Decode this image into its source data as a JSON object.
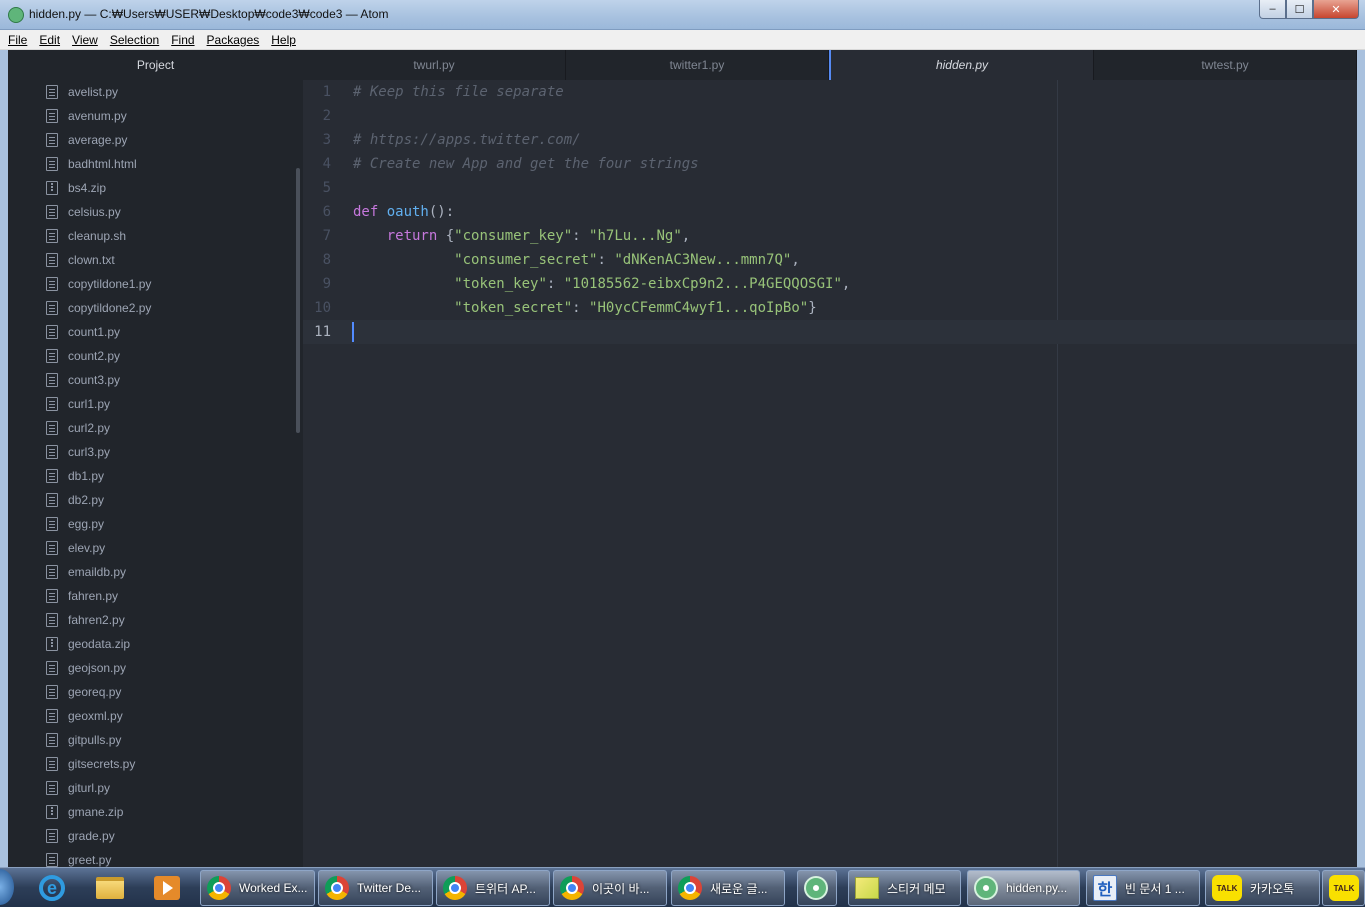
{
  "window": {
    "title": "hidden.py — C:₩Users₩USER₩Desktop₩code3₩code3 — Atom",
    "minimize": "‒",
    "maximize": "☐",
    "close": "✕"
  },
  "menu": [
    "File",
    "Edit",
    "View",
    "Selection",
    "Find",
    "Packages",
    "Help"
  ],
  "tree": {
    "header": "Project",
    "items": [
      {
        "name": "avelist.py",
        "icon": "file-icon"
      },
      {
        "name": "avenum.py",
        "icon": "file-icon"
      },
      {
        "name": "average.py",
        "icon": "file-icon"
      },
      {
        "name": "badhtml.html",
        "icon": "file-icon"
      },
      {
        "name": "bs4.zip",
        "icon": "zip-icon"
      },
      {
        "name": "celsius.py",
        "icon": "file-icon"
      },
      {
        "name": "cleanup.sh",
        "icon": "file-icon"
      },
      {
        "name": "clown.txt",
        "icon": "file-icon"
      },
      {
        "name": "copytildone1.py",
        "icon": "file-icon"
      },
      {
        "name": "copytildone2.py",
        "icon": "file-icon"
      },
      {
        "name": "count1.py",
        "icon": "file-icon"
      },
      {
        "name": "count2.py",
        "icon": "file-icon"
      },
      {
        "name": "count3.py",
        "icon": "file-icon"
      },
      {
        "name": "curl1.py",
        "icon": "file-icon"
      },
      {
        "name": "curl2.py",
        "icon": "file-icon"
      },
      {
        "name": "curl3.py",
        "icon": "file-icon"
      },
      {
        "name": "db1.py",
        "icon": "file-icon"
      },
      {
        "name": "db2.py",
        "icon": "file-icon"
      },
      {
        "name": "egg.py",
        "icon": "file-icon"
      },
      {
        "name": "elev.py",
        "icon": "file-icon"
      },
      {
        "name": "emaildb.py",
        "icon": "file-icon"
      },
      {
        "name": "fahren.py",
        "icon": "file-icon"
      },
      {
        "name": "fahren2.py",
        "icon": "file-icon"
      },
      {
        "name": "geodata.zip",
        "icon": "zip-icon"
      },
      {
        "name": "geojson.py",
        "icon": "file-icon"
      },
      {
        "name": "georeq.py",
        "icon": "file-icon"
      },
      {
        "name": "geoxml.py",
        "icon": "file-icon"
      },
      {
        "name": "gitpulls.py",
        "icon": "file-icon"
      },
      {
        "name": "gitsecrets.py",
        "icon": "file-icon"
      },
      {
        "name": "giturl.py",
        "icon": "file-icon"
      },
      {
        "name": "gmane.zip",
        "icon": "zip-icon"
      },
      {
        "name": "grade.py",
        "icon": "file-icon"
      },
      {
        "name": "greet.py",
        "icon": "file-icon"
      }
    ]
  },
  "tabs": [
    {
      "label": "twurl.py",
      "active": false
    },
    {
      "label": "twitter1.py",
      "active": false
    },
    {
      "label": "hidden.py",
      "active": true
    },
    {
      "label": "twtest.py",
      "active": false
    }
  ],
  "editor": {
    "cursor_line": 11,
    "lines": [
      {
        "n": "1",
        "tokens": [
          {
            "t": "# Keep this file separate",
            "c": "c-comment"
          }
        ]
      },
      {
        "n": "2",
        "tokens": []
      },
      {
        "n": "3",
        "tokens": [
          {
            "t": "# https://apps.twitter.com/",
            "c": "c-comment"
          }
        ]
      },
      {
        "n": "4",
        "tokens": [
          {
            "t": "# Create new App and get the four strings",
            "c": "c-comment"
          }
        ]
      },
      {
        "n": "5",
        "tokens": []
      },
      {
        "n": "6",
        "tokens": [
          {
            "t": "def ",
            "c": "c-kw"
          },
          {
            "t": "oauth",
            "c": "c-fn"
          },
          {
            "t": "():",
            "c": "c-punc"
          }
        ]
      },
      {
        "n": "7",
        "tokens": [
          {
            "t": "    ",
            "c": "c-punc"
          },
          {
            "t": "return",
            "c": "c-kw"
          },
          {
            "t": " {",
            "c": "c-punc"
          },
          {
            "t": "\"consumer_key\"",
            "c": "c-str"
          },
          {
            "t": ": ",
            "c": "c-punc"
          },
          {
            "t": "\"h7Lu...Ng\"",
            "c": "c-str"
          },
          {
            "t": ",",
            "c": "c-punc"
          }
        ]
      },
      {
        "n": "8",
        "tokens": [
          {
            "t": "            ",
            "c": "c-punc"
          },
          {
            "t": "\"consumer_secret\"",
            "c": "c-str"
          },
          {
            "t": ": ",
            "c": "c-punc"
          },
          {
            "t": "\"dNKenAC3New...mmn7Q\"",
            "c": "c-str"
          },
          {
            "t": ",",
            "c": "c-punc"
          }
        ]
      },
      {
        "n": "9",
        "tokens": [
          {
            "t": "            ",
            "c": "c-punc"
          },
          {
            "t": "\"token_key\"",
            "c": "c-str"
          },
          {
            "t": ": ",
            "c": "c-punc"
          },
          {
            "t": "\"10185562-eibxCp9n2...P4GEQQOSGI\"",
            "c": "c-str"
          },
          {
            "t": ",",
            "c": "c-punc"
          }
        ]
      },
      {
        "n": "10",
        "tokens": [
          {
            "t": "            ",
            "c": "c-punc"
          },
          {
            "t": "\"token_secret\"",
            "c": "c-str"
          },
          {
            "t": ": ",
            "c": "c-punc"
          },
          {
            "t": "\"H0ycCFemmC4wyf1...qoIpBo\"",
            "c": "c-str"
          },
          {
            "t": "}",
            "c": "c-punc"
          }
        ]
      },
      {
        "n": "11",
        "tokens": []
      }
    ]
  },
  "taskbar": {
    "pinned": [
      {
        "name": "internet-explorer-icon",
        "glyph": "e"
      },
      {
        "name": "file-explorer-icon",
        "glyph": ""
      },
      {
        "name": "media-player-icon",
        "glyph": ""
      }
    ],
    "tasks": [
      {
        "label": "Worked Ex...",
        "icon": "chrome",
        "active": false
      },
      {
        "label": "Twitter De...",
        "icon": "chrome",
        "active": false
      },
      {
        "label": "트위터 AP...",
        "icon": "chrome",
        "active": false
      },
      {
        "label": "이곳이 바...",
        "icon": "chrome",
        "active": false
      },
      {
        "label": "새로운 글...",
        "icon": "chrome",
        "active": false
      },
      {
        "label": "",
        "icon": "atom",
        "active": false
      },
      {
        "label": "스티커 메모",
        "icon": "sticky",
        "active": false
      },
      {
        "label": "hidden.py...",
        "icon": "atom",
        "active": true
      },
      {
        "label": "빈 문서 1 ...",
        "icon": "hwp",
        "active": false
      },
      {
        "label": "카카오톡",
        "icon": "talk",
        "active": false
      },
      {
        "label": "",
        "icon": "talk",
        "active": false
      }
    ],
    "hwp_glyph": "한",
    "talk_glyph": "TALK"
  }
}
